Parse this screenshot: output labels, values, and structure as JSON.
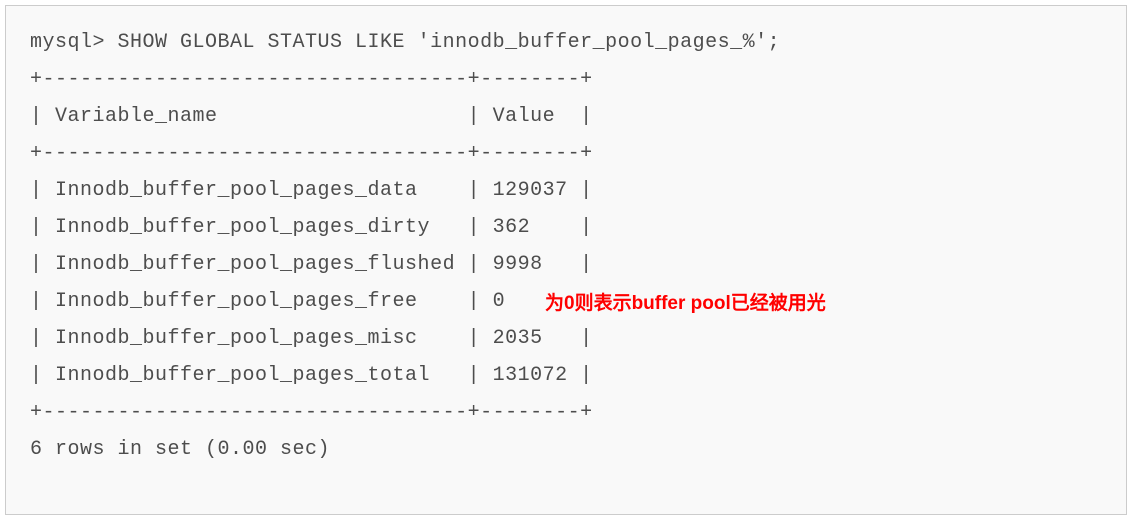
{
  "terminal": {
    "prompt": "mysql> ",
    "command": "SHOW GLOBAL STATUS LIKE 'innodb_buffer_pool_pages_%';",
    "separator_top": "+----------------------------------+--------+",
    "header": "| Variable_name                    | Value  |",
    "separator_mid": "+----------------------------------+--------+",
    "rows": [
      "| Innodb_buffer_pool_pages_data    | 129037 |",
      "| Innodb_buffer_pool_pages_dirty   | 362    |",
      "| Innodb_buffer_pool_pages_flushed | 9998   |",
      "| Innodb_buffer_pool_pages_free    | 0",
      "| Innodb_buffer_pool_pages_misc    | 2035   |",
      "| Innodb_buffer_pool_pages_total   | 131072 |"
    ],
    "separator_bot": "+----------------------------------+--------+",
    "footer": "6 rows in set (0.00 sec)"
  },
  "annotation": {
    "text": "为0则表示buffer pool已经被用光",
    "row_index": 3
  },
  "chart_data": {
    "type": "table",
    "title": "SHOW GLOBAL STATUS LIKE 'innodb_buffer_pool_pages_%'",
    "columns": [
      "Variable_name",
      "Value"
    ],
    "rows": [
      [
        "Innodb_buffer_pool_pages_data",
        129037
      ],
      [
        "Innodb_buffer_pool_pages_dirty",
        362
      ],
      [
        "Innodb_buffer_pool_pages_flushed",
        9998
      ],
      [
        "Innodb_buffer_pool_pages_free",
        0
      ],
      [
        "Innodb_buffer_pool_pages_misc",
        2035
      ],
      [
        "Innodb_buffer_pool_pages_total",
        131072
      ]
    ],
    "footer": "6 rows in set (0.00 sec)"
  }
}
